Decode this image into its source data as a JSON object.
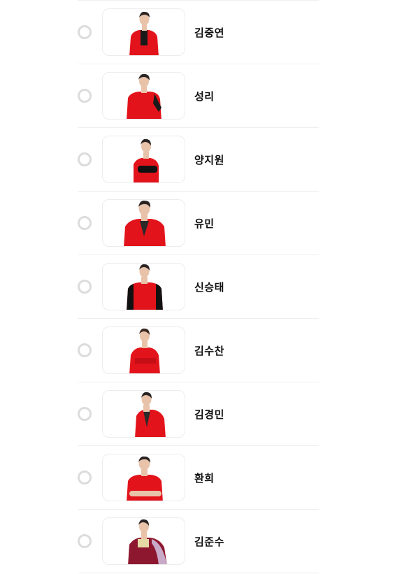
{
  "vote_list": {
    "candidates": [
      {
        "name": "김중연",
        "photo": "candidate-photo"
      },
      {
        "name": "성리",
        "photo": "candidate-photo"
      },
      {
        "name": "양지원",
        "photo": "candidate-photo"
      },
      {
        "name": "유민",
        "photo": "candidate-photo"
      },
      {
        "name": "신승태",
        "photo": "candidate-photo"
      },
      {
        "name": "김수찬",
        "photo": "candidate-photo"
      },
      {
        "name": "김경민",
        "photo": "candidate-photo"
      },
      {
        "name": "환희",
        "photo": "candidate-photo"
      },
      {
        "name": "김준수",
        "photo": "candidate-photo"
      }
    ],
    "colors": {
      "radio_border": "#dcdcdc",
      "outfit_red": "#e3131b",
      "hair": "#2b2424",
      "skin": "#e8c3aa"
    }
  }
}
